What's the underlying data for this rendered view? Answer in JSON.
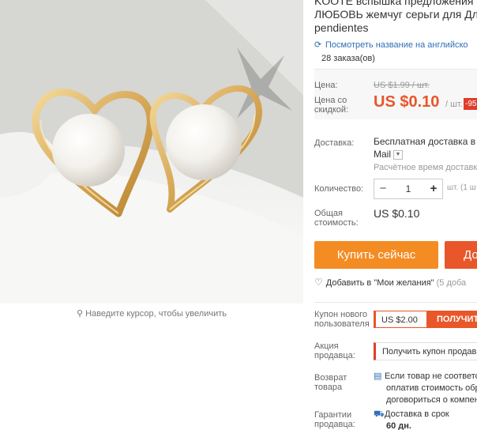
{
  "product": {
    "title_lines": [
      "KOOTE вспышка предложения кл",
      "ЛЮБОВЬ жемчуг серьги для Для з",
      "pendientes"
    ],
    "translate_link": "Посмотреть название на английско",
    "orders": "28 заказа(ов)"
  },
  "gallery": {
    "zoom_hint": "Наведите курсор, чтобы увеличить"
  },
  "price": {
    "label": "Цена:",
    "old_value": "US $1.99 / шт.",
    "discount_label_line1": "Цена со",
    "discount_label_line2": "скидкой:",
    "new_value": "US $0.10",
    "unit": "/ шт.",
    "discount_badge": "-95"
  },
  "shipping": {
    "label": "Доставка:",
    "line1": "Бесплатная доставка в R",
    "line2": "Mail",
    "estimate": "Расчётное время доставки"
  },
  "quantity": {
    "label": "Количество:",
    "value": "1",
    "minus": "−",
    "plus": "+",
    "unit_note": "шт. (1 ш"
  },
  "total": {
    "label_line1": "Общая",
    "label_line2": "стоимость:",
    "value": "US $0.10"
  },
  "actions": {
    "buy_now": "Купить сейчас",
    "add_to_cart": "До",
    "wishlist": "Добавить в \"Мои желания\"",
    "wishlist_count": "(5 доба"
  },
  "coupon": {
    "label_line1": "Купон нового",
    "label_line2": "пользователя",
    "value": "US $2.00",
    "button": "ПОЛУЧИТ"
  },
  "seller_promo": {
    "label_line1": "Акция",
    "label_line2": "продавца:",
    "text": "Получить купон продав"
  },
  "returns": {
    "label_line1": "Возврат",
    "label_line2": "товара",
    "line1": "Если товар не соответс",
    "line2": "оплатив стоимость обр",
    "line3": "договориться о компен"
  },
  "guarantee": {
    "label_line1": "Гарантии",
    "label_line2": "продавца:",
    "line1": "Доставка в срок",
    "line2": "60 дн."
  },
  "colors": {
    "accent_orange": "#f48c24",
    "accent_red": "#e8562a",
    "link_blue": "#2f6eb5"
  }
}
